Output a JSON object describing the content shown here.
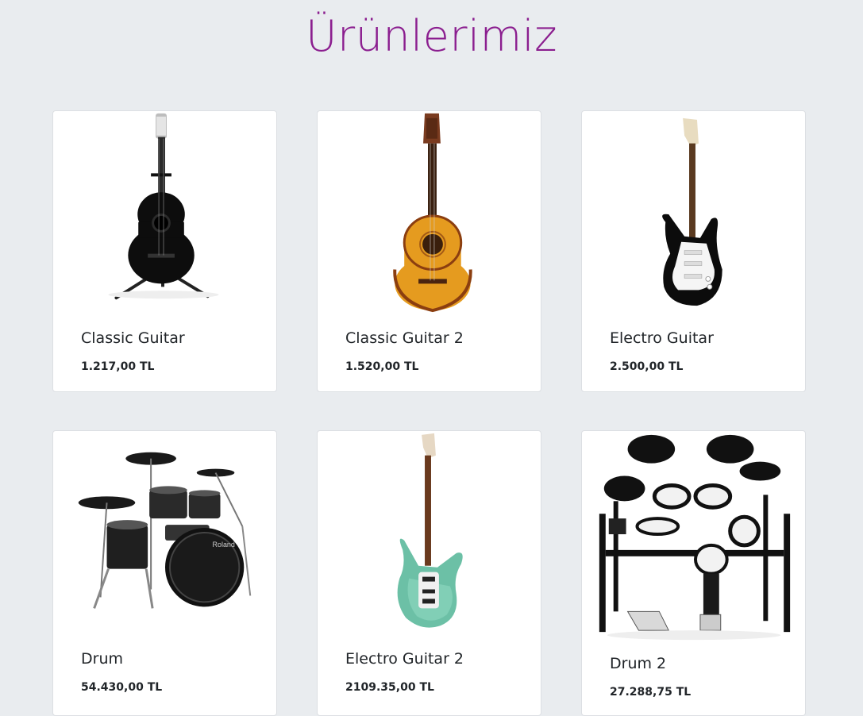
{
  "page": {
    "title": "Ürünlerimiz"
  },
  "products": [
    {
      "name": "Classic Guitar",
      "price": "1.217,00 TL",
      "icon": "classic-guitar-black"
    },
    {
      "name": "Classic Guitar 2",
      "price": "1.520,00 TL",
      "icon": "classic-guitar-natural"
    },
    {
      "name": "Electro Guitar",
      "price": "2.500,00 TL",
      "icon": "electric-guitar-black"
    },
    {
      "name": "Drum",
      "price": "54.430,00 TL",
      "icon": "drum-kit-acoustic"
    },
    {
      "name": "Electro Guitar 2",
      "price": "2109.35,00 TL",
      "icon": "electric-guitar-mint"
    },
    {
      "name": "Drum 2",
      "price": "27.288,75 TL",
      "icon": "drum-kit-electronic"
    }
  ],
  "colors": {
    "title": "#8b1e8f",
    "background": "#e9ecef",
    "card": "#ffffff"
  }
}
